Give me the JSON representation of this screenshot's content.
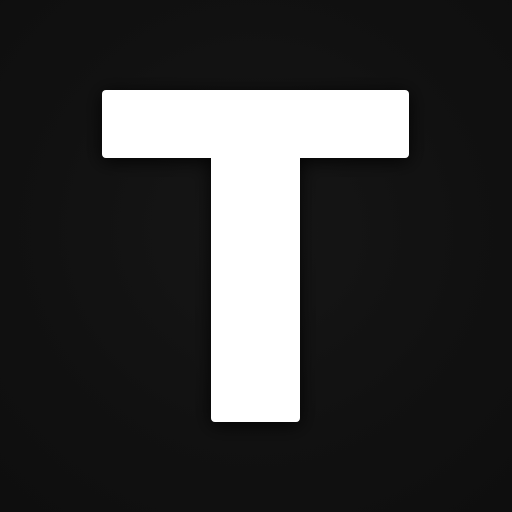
{
  "logo": {
    "icon": "letter-t-logo-icon",
    "letter": "T",
    "fill_color": "#ffffff",
    "background_color": "#111111"
  }
}
